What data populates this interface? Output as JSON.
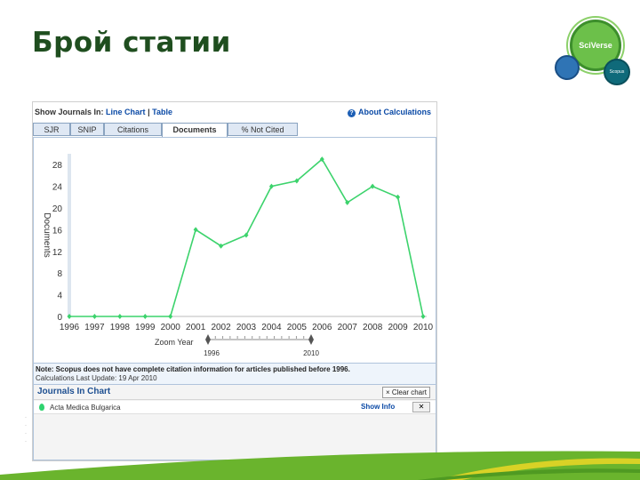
{
  "slide": {
    "title": "Брой статии"
  },
  "logos": {
    "sciverse": "SciVerse",
    "scopus": "Scopus"
  },
  "toolbar": {
    "show_label": "Show Journals In:",
    "line_chart": "Line Chart",
    "separator": "|",
    "table": "Table",
    "about": "About Calculations",
    "about_icon": "question-icon"
  },
  "tabs": [
    {
      "label": "SJR",
      "active": false
    },
    {
      "label": "SNIP",
      "active": false
    },
    {
      "label": "Citations",
      "active": false
    },
    {
      "label": "Documents",
      "active": true
    },
    {
      "label": "% Not Cited",
      "active": false
    }
  ],
  "chart_data": {
    "type": "line",
    "ylabel": "Documents",
    "x": [
      "1996",
      "1997",
      "1998",
      "1999",
      "2000",
      "2001",
      "2002",
      "2003",
      "2004",
      "2005",
      "2006",
      "2007",
      "2008",
      "2009",
      "2010"
    ],
    "series": [
      {
        "color": "#3cd36c",
        "values": [
          0,
          0,
          0,
          0,
          0,
          16,
          13,
          15,
          24,
          25,
          29,
          21,
          24,
          22,
          0
        ]
      }
    ],
    "ylim": [
      0,
      30
    ],
    "yticks": [
      0,
      4,
      8,
      12,
      16,
      20,
      24,
      28
    ],
    "ytick_labels": [
      "0",
      "4",
      "8",
      "12",
      "16",
      "20",
      "24",
      "28"
    ],
    "grid": false,
    "zoom": {
      "label": "Zoom Year",
      "start": "1996",
      "end": "2010"
    }
  },
  "notes": {
    "line1": "Note: Scopus does not have complete citation information for articles published before 1996.",
    "line2": "Calculations Last Update: 19 Apr 2010"
  },
  "journals": {
    "title": "Journals In Chart",
    "clear": "× Clear chart",
    "rows": [
      {
        "name": "Acta Medica Bulgarica",
        "show_info": "Show Info",
        "remove": "✕"
      }
    ]
  },
  "colors": {
    "title": "#1f4e1f",
    "line": "#3cd36c",
    "link": "#0b4aa6",
    "swoosh_green": "#6ab42d",
    "swoosh_yellow": "#d9d226"
  }
}
